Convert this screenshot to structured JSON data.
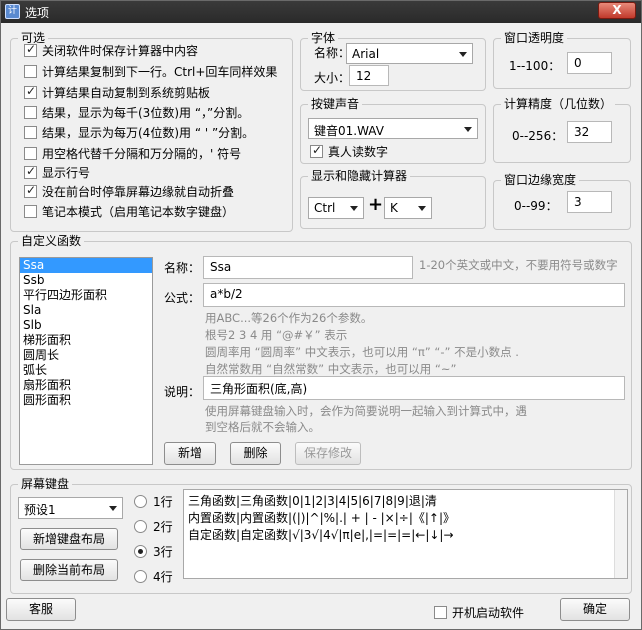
{
  "window": {
    "title": "选项",
    "close": "X",
    "app_icon_glyph": "计"
  },
  "optional": {
    "title": "可选",
    "items": [
      {
        "label": "关闭软件时保存计算器中内容",
        "checked": true
      },
      {
        "label": "计算结果复制到下一行。Ctrl+回车同样效果",
        "checked": false
      },
      {
        "label": "计算结果自动复制到系统剪贴板",
        "checked": true
      },
      {
        "label": "结果，显示为每千(3位数)用 “，”分割。",
        "checked": false
      },
      {
        "label": "结果，显示为每万(4位数)用 “ ' ”分割。",
        "checked": false
      },
      {
        "label": "用空格代替千分隔和万分隔的，' 符号",
        "checked": false
      },
      {
        "label": "显示行号",
        "checked": true
      },
      {
        "label": "没在前台时停靠屏幕边缘就自动折叠",
        "checked": true
      },
      {
        "label": "笔记本模式（启用笔记本数字键盘）",
        "checked": false
      }
    ]
  },
  "font": {
    "title": "字体",
    "name_label": "名称：",
    "name_value": "Arial",
    "size_label": "大小：",
    "size_value": "12"
  },
  "opacity": {
    "title": "窗口透明度",
    "range_label": "1--100：",
    "value": "0"
  },
  "keysound": {
    "title": "按键声音",
    "sound_value": "键音01.WAV",
    "voice_label": "真人读数字",
    "voice_checked": true
  },
  "precision": {
    "title": "计算精度（几位数）",
    "range_label": "0--256：",
    "value": "32"
  },
  "hotkey": {
    "title": "显示和隐藏计算器",
    "modifier": "Ctrl",
    "plus": "+",
    "key": "K"
  },
  "border": {
    "title": "窗口边缘宽度",
    "range_label": "0--99：",
    "value": "3"
  },
  "custom": {
    "title": "自定义函数",
    "functions": [
      "Ssa",
      "Ssb",
      "平行四边形面积",
      "Sla",
      "Slb",
      "梯形面积",
      "圆周长",
      "弧长",
      "扇形面积",
      "圆形面积"
    ],
    "selected_index": 0,
    "name_label": "名称：",
    "name_value": "Ssa",
    "name_hint": "1-20个英文或中文，不要用符号或数字",
    "formula_label": "公式：",
    "formula_value": "a*b/2",
    "formula_help": [
      "用ABC...等26个作为26个参数。",
      "根号2 3 4 用 “@#￥” 表示",
      "圆周率用 “圆周率” 中文表示，也可以用 “π”  “-” 不是小数点 .",
      "自然常数用 “自然常数” 中文表示，也可以用 “~”"
    ],
    "desc_label": "说明：",
    "desc_value": "三角形面积(底,高)",
    "desc_help": [
      "使用屏幕键盘输入时，会作为简要说明一起输入到计算式中，遇",
      "到空格后就不会输入。"
    ],
    "add_button": "新增",
    "delete_button": "删除",
    "save_button": "保存修改"
  },
  "keyboard": {
    "title": "屏幕键盘",
    "preset_value": "预设1",
    "new_layout_button": "新增键盘布局",
    "delete_layout_button": "删除当前布局",
    "rows_options": [
      "1行",
      "2行",
      "3行",
      "4行"
    ],
    "rows_selected": 2,
    "layout_lines": [
      "三角函数|三角函数|0|1|2|3|4|5|6|7|8|9|退|清",
      "内置函数|内置函数|(|)|^|%|.| + | - |×|÷|《|↑|》",
      "自定函数|自定函数|√|3√|4√|π|e|,|=|=|=|←|↓|→"
    ]
  },
  "footer": {
    "service_button": "客服",
    "autostart_label": "开机启动软件",
    "autostart_checked": false,
    "ok_button": "确定"
  }
}
